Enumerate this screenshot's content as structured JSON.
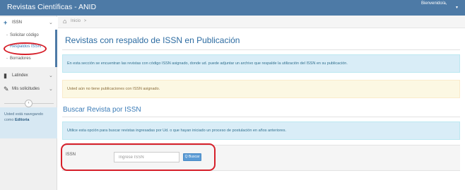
{
  "app": {
    "title": "Revistas Científicas - ANID",
    "welcome": "Bienvenido/a,",
    "user_caret": "▾"
  },
  "sidebar": {
    "sections": [
      {
        "icon": "+",
        "label": "ISSN",
        "chevron": "⌄"
      },
      {
        "icon": "▮",
        "label": "Latindex",
        "chevron": "⌄"
      },
      {
        "icon": "✎",
        "label": "Mis solicitudes",
        "chevron": "⌄"
      }
    ],
    "issn_items": [
      {
        "label": "Solicitar código",
        "active": false
      },
      {
        "label": "Respaldos ISSN",
        "active": true
      },
      {
        "label": "Borradores",
        "active": false
      }
    ],
    "collapse_symbol": "‹",
    "nav_info_prefix": "Usted está navegando",
    "nav_info_middle": "como",
    "nav_info_role": "Editoria"
  },
  "breadcrumb": {
    "home_icon": "home-icon",
    "current": "Inicio",
    "separator": ">"
  },
  "main": {
    "title": "Revistas con respaldo de ISSN en Publicación",
    "info_text": "En esta sección se encuentran las revistas con código ISSN asignado, donde ud. puede adjuntar un archivo que respalde la utilización del ISSN en su publicación.",
    "warning_text": "Usted aún no tiene publicaciones con ISSN asignado.",
    "search_title": "Buscar Revista por ISSN",
    "search_info": "Utilice esta opción para buscar revistas ingresadas por Ud. o que hayan iniciado un proceso de postulación en años anteriores.",
    "form": {
      "label": "ISSN",
      "placeholder": "Ingrese ISSN",
      "value": "",
      "button_label": "Q Buscar"
    }
  },
  "colors": {
    "topbar": "#4d7aa6",
    "annotation": "#d6202a",
    "info_bg": "#d9edf7",
    "warning_bg": "#fcf8e3"
  }
}
